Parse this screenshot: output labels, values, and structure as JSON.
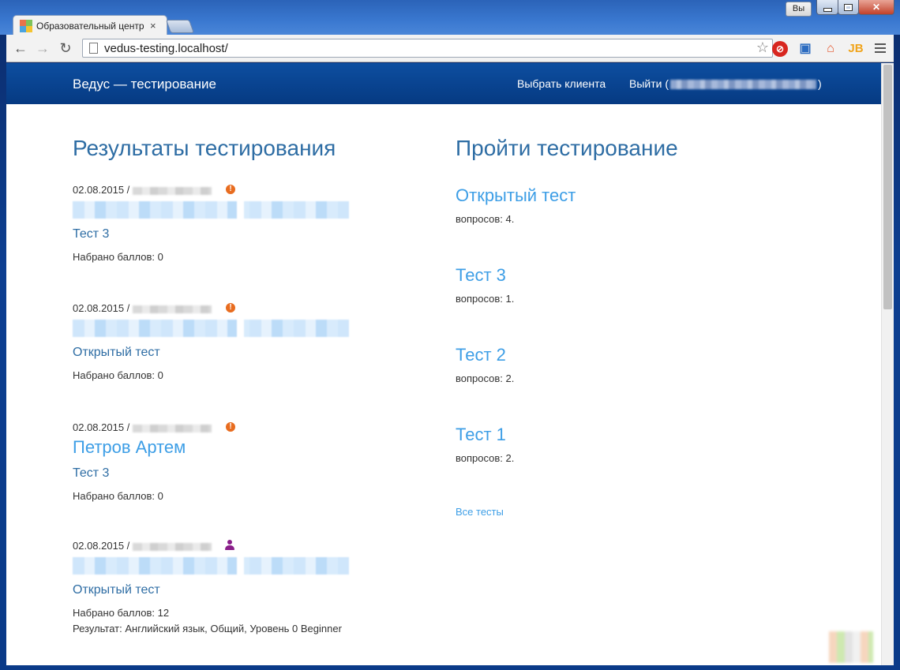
{
  "window": {
    "user_badge": "Вы",
    "tab_title": "Образовательный центр",
    "tab_close": "×"
  },
  "toolbar": {
    "url": "vedus-testing.localhost/",
    "back": "←",
    "forward": "→",
    "reload": "↻",
    "star": "☆",
    "ext_folder": "▣",
    "ext_home": "⌂",
    "ext_jb": "JB"
  },
  "navbar": {
    "brand": "Ведус — тестирование",
    "choose_client": "Выбрать клиента",
    "logout_prefix": "Выйти (",
    "logout_suffix": ")"
  },
  "results": {
    "title": "Результаты тестирования",
    "items": [
      {
        "date": "02.08.2015 /",
        "status": "warning",
        "name": "",
        "test": "Тест 3",
        "score": "Набрано баллов: 0",
        "result": ""
      },
      {
        "date": "02.08.2015 /",
        "status": "warning",
        "name": "",
        "test": "Открытый тест",
        "score": "Набрано баллов: 0",
        "result": ""
      },
      {
        "date": "02.08.2015 /",
        "status": "warning",
        "name": "Петров Артем",
        "test": "Тест 3",
        "score": "Набрано баллов: 0",
        "result": ""
      },
      {
        "date": "02.08.2015 /",
        "status": "user",
        "name": "",
        "test": "Открытый тест",
        "score": "Набрано баллов: 12",
        "result": "Результат: Английский язык, Общий, Уровень 0 Beginner"
      }
    ]
  },
  "tests": {
    "title": "Пройти тестирование",
    "items": [
      {
        "title": "Открытый тест",
        "count": "вопросов: 4."
      },
      {
        "title": "Тест 3",
        "count": "вопросов: 1."
      },
      {
        "title": "Тест 2",
        "count": "вопросов: 2."
      },
      {
        "title": "Тест 1",
        "count": "вопросов: 2."
      }
    ],
    "all_tests": "Все тесты"
  },
  "colors": {
    "navbar": "#063a82",
    "link": "#3d9ee6",
    "heading": "#2e6da4",
    "warning": "#e86c1f",
    "user_icon": "#8a1f8a"
  }
}
